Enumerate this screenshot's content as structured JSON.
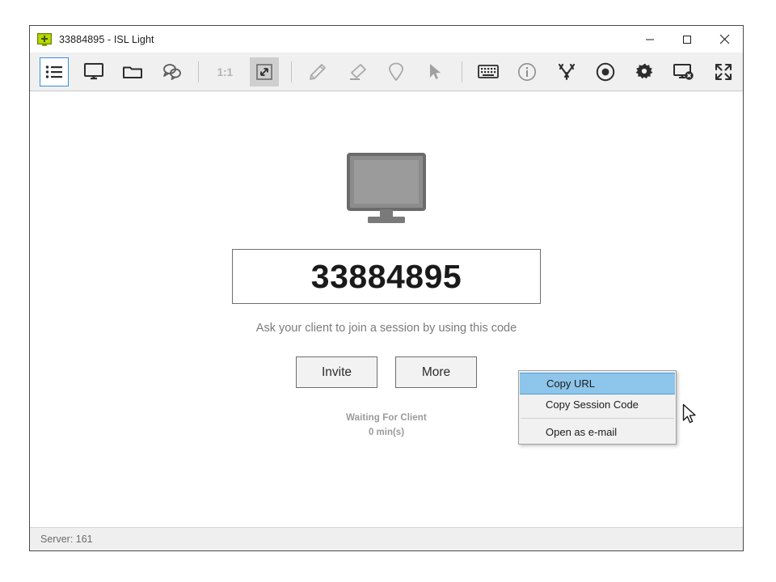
{
  "window": {
    "title": "33884895 - ISL Light",
    "app_icon": "monitor-plus-icon",
    "controls": {
      "minimize_label": "Minimize",
      "maximize_label": "Maximize",
      "close_label": "Close"
    }
  },
  "toolbar": {
    "items": [
      {
        "name": "session-list-icon",
        "label": "",
        "state": "selected"
      },
      {
        "name": "monitor-icon",
        "label": "",
        "state": "normal"
      },
      {
        "name": "folder-icon",
        "label": "",
        "state": "normal"
      },
      {
        "name": "chat-bubbles-icon",
        "label": "",
        "state": "normal"
      },
      {
        "name": "scale-one-to-one",
        "label": "1:1",
        "state": "disabled"
      },
      {
        "name": "fit-to-window-icon",
        "label": "",
        "state": "pressed"
      },
      {
        "name": "pencil-icon",
        "label": "",
        "state": "disabled"
      },
      {
        "name": "eraser-icon",
        "label": "",
        "state": "disabled"
      },
      {
        "name": "marker-pin-icon",
        "label": "",
        "state": "disabled"
      },
      {
        "name": "pointer-arrow-icon",
        "label": "",
        "state": "disabled"
      },
      {
        "name": "keyboard-icon",
        "label": "",
        "state": "normal"
      },
      {
        "name": "info-icon",
        "label": "",
        "state": "normal"
      },
      {
        "name": "tools-icon",
        "label": "",
        "state": "normal"
      },
      {
        "name": "record-icon",
        "label": "",
        "state": "normal"
      },
      {
        "name": "settings-gear-icon",
        "label": "",
        "state": "normal"
      },
      {
        "name": "disconnect-icon",
        "label": "",
        "state": "normal"
      },
      {
        "name": "fullscreen-icon",
        "label": "",
        "state": "normal"
      }
    ]
  },
  "main": {
    "illustration": "monitor-illustration",
    "session_code": "33884895",
    "join_hint": "Ask your client to join a session by using this code",
    "buttons": {
      "invite": "Invite",
      "more": "More"
    },
    "status": {
      "waiting": "Waiting For Client",
      "duration": "0 min(s)"
    }
  },
  "context_menu": {
    "items": [
      {
        "label": "Copy URL",
        "highlighted": true
      },
      {
        "label": "Copy Session Code",
        "highlighted": false
      },
      {
        "label": "Open as e-mail",
        "highlighted": false
      }
    ],
    "highlight_color": "#8ec5ea"
  },
  "status_bar": {
    "server": "Server: 161"
  }
}
